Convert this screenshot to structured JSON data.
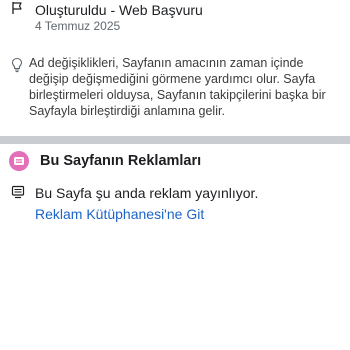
{
  "history": {
    "event_title": "Oluşturuldu - Web Başvuru",
    "event_date": "4 Temmuz 2025",
    "event_icon": "flag-icon"
  },
  "info": {
    "icon": "lightbulb-icon",
    "lines": [
      "Ad değişiklikleri, Sayfanın amacının zaman içinde",
      "değişip değişmediğini görmene yardımcı olur. Sayfa",
      "birleştirmeleri olduysa, Sayfanın takipçilerini başka bir",
      "Sayfayla birleştirdiği anlamına gelir."
    ]
  },
  "ads_section": {
    "title": "Bu Sayfanın Reklamları",
    "title_icon": "ads-icon",
    "accent_color": "#e36fb8",
    "status_icon": "monitor-icon",
    "status_text": "Bu Sayfa şu anda reklam yayınlıyor.",
    "link_text": "Reklam Kütüphanesi'ne Git",
    "link_color": "#1b64c8"
  },
  "colors": {
    "divider": "#c9ccd1",
    "primary_text": "#1c1e21",
    "secondary_text": "#606770"
  }
}
